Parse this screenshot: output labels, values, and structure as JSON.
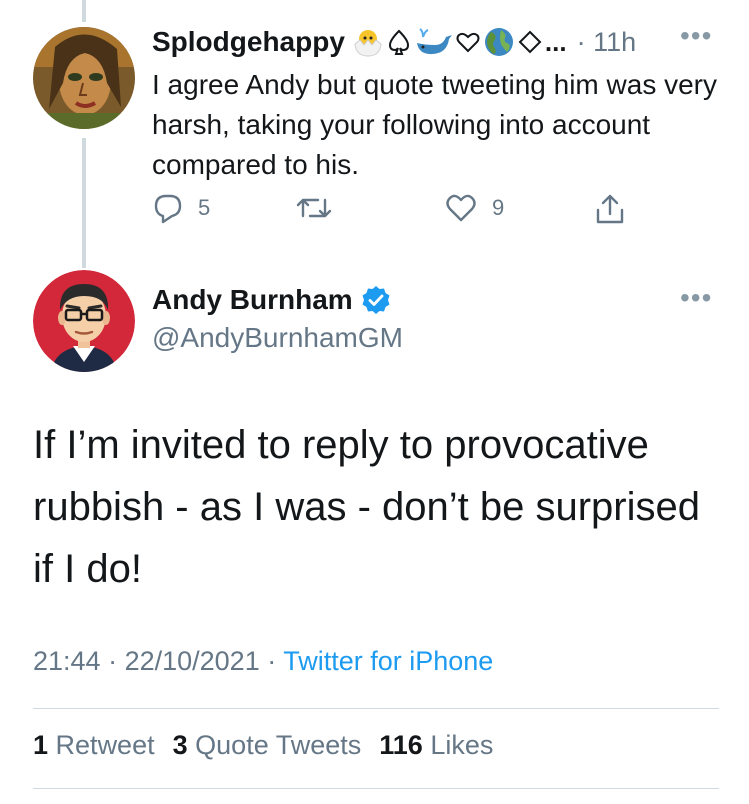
{
  "reply": {
    "display_name": "Splodgehappy",
    "name_emojis": [
      "hatching-chick",
      "spade-suit",
      "whale",
      "heart-outline",
      "globe",
      "diamond-outline"
    ],
    "name_ellipsis": "...",
    "time": "· 11h",
    "text": "I agree Andy but quote tweeting him was very harsh, taking your following into account compared to his.",
    "actions": {
      "reply_count": "5",
      "like_count": "9"
    }
  },
  "tweet": {
    "display_name": "Andy Burnham",
    "handle": "@AndyBurnhamGM",
    "verified": true,
    "text": "If I’m invited to reply to provocative rubbish - as I was - don’t be surprised if I do!",
    "time": "21:44",
    "sep1": " · ",
    "date": "22/10/2021",
    "sep2": " · ",
    "source": "Twitter for iPhone",
    "stats": {
      "retweets_count": "1",
      "retweets_label": "Retweet",
      "quotes_count": "3",
      "quotes_label": "Quote Tweets",
      "likes_count": "116",
      "likes_label": "Likes"
    }
  },
  "more_icon": "•••",
  "colors": {
    "link": "#1d9bf0",
    "secondary_text": "#657786",
    "primary_text": "#14171a",
    "verified_badge": "#1d9bf0"
  }
}
